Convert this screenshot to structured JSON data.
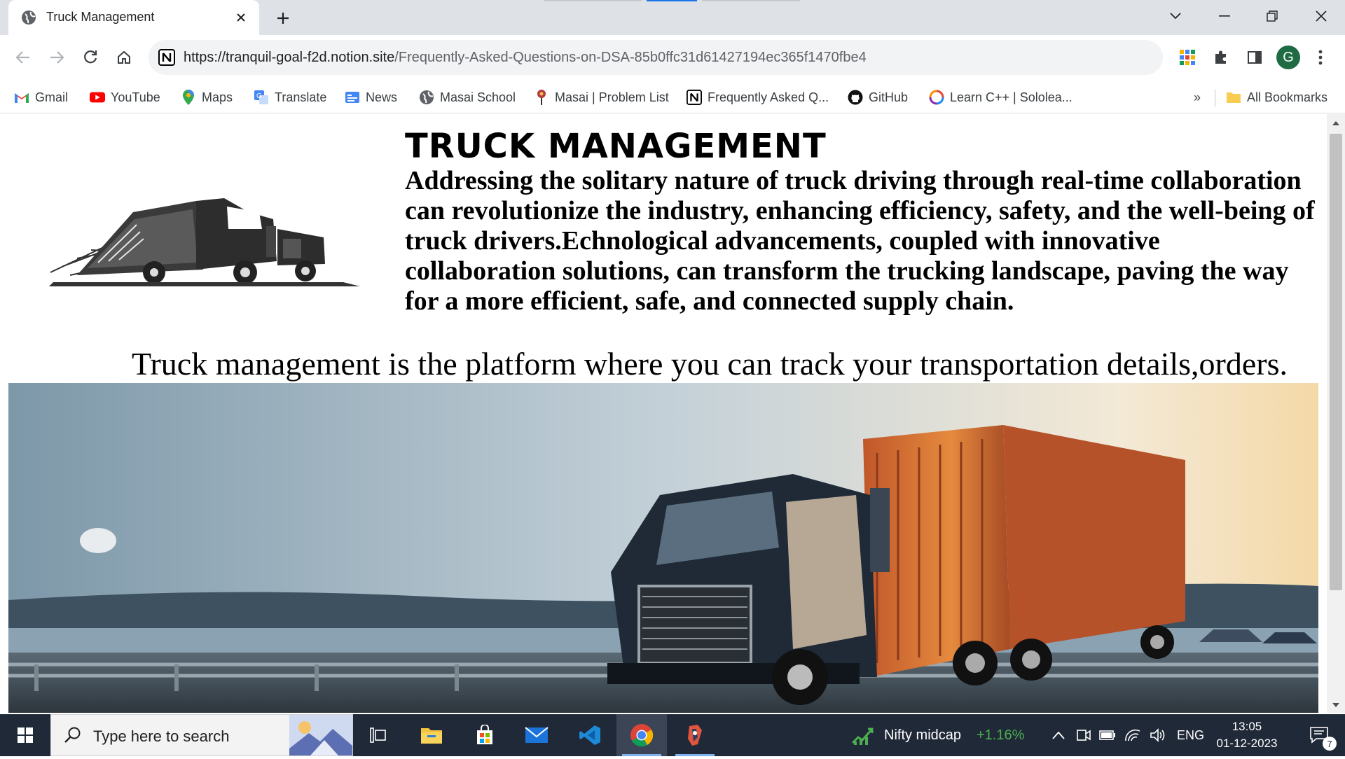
{
  "browser": {
    "tab_title": "Truck Management",
    "url_host": "https://tranquil-goal-f2d.notion.site",
    "url_path": "/Frequently-Asked-Questions-on-DSA-85b0ffc31d61427194ec365f1470fbe4",
    "profile_initial": "G"
  },
  "bookmarks": {
    "items": [
      {
        "label": "Gmail",
        "icon": "gmail-icon"
      },
      {
        "label": "YouTube",
        "icon": "youtube-icon"
      },
      {
        "label": "Maps",
        "icon": "maps-icon"
      },
      {
        "label": "Translate",
        "icon": "translate-icon"
      },
      {
        "label": "News",
        "icon": "news-icon"
      },
      {
        "label": "Masai School",
        "icon": "globe-icon"
      },
      {
        "label": "Masai | Problem List",
        "icon": "masai-icon"
      },
      {
        "label": "Frequently Asked Q...",
        "icon": "notion-icon"
      },
      {
        "label": "GitHub",
        "icon": "github-icon"
      },
      {
        "label": "Learn C++ | Sololea...",
        "icon": "sololearn-icon"
      }
    ],
    "overflow": "»",
    "all_bookmarks": "All Bookmarks"
  },
  "page": {
    "heading": "TRUCK MANAGEMENT",
    "description": "Addressing the solitary nature of truck driving through real-time collaboration can revolutionize the industry, enhancing efficiency, safety, and the well-being of truck drivers.Echnological advancements, coupled with innovative collaboration solutions, can transform the trucking landscape, paving the way for a more efficient, safe, and connected supply chain.",
    "tagline": "Truck management is the platform where you can track your transportation details,orders."
  },
  "taskbar": {
    "search_placeholder": "Type here to search",
    "widget_label": "Nifty midcap",
    "widget_value": "+1.16%",
    "language": "ENG",
    "time": "13:05",
    "date": "01-12-2023",
    "notification_count": "7"
  },
  "colors": {
    "tab_strip": "#dee1e6",
    "taskbar": "#202938",
    "positive": "#4caf50"
  }
}
